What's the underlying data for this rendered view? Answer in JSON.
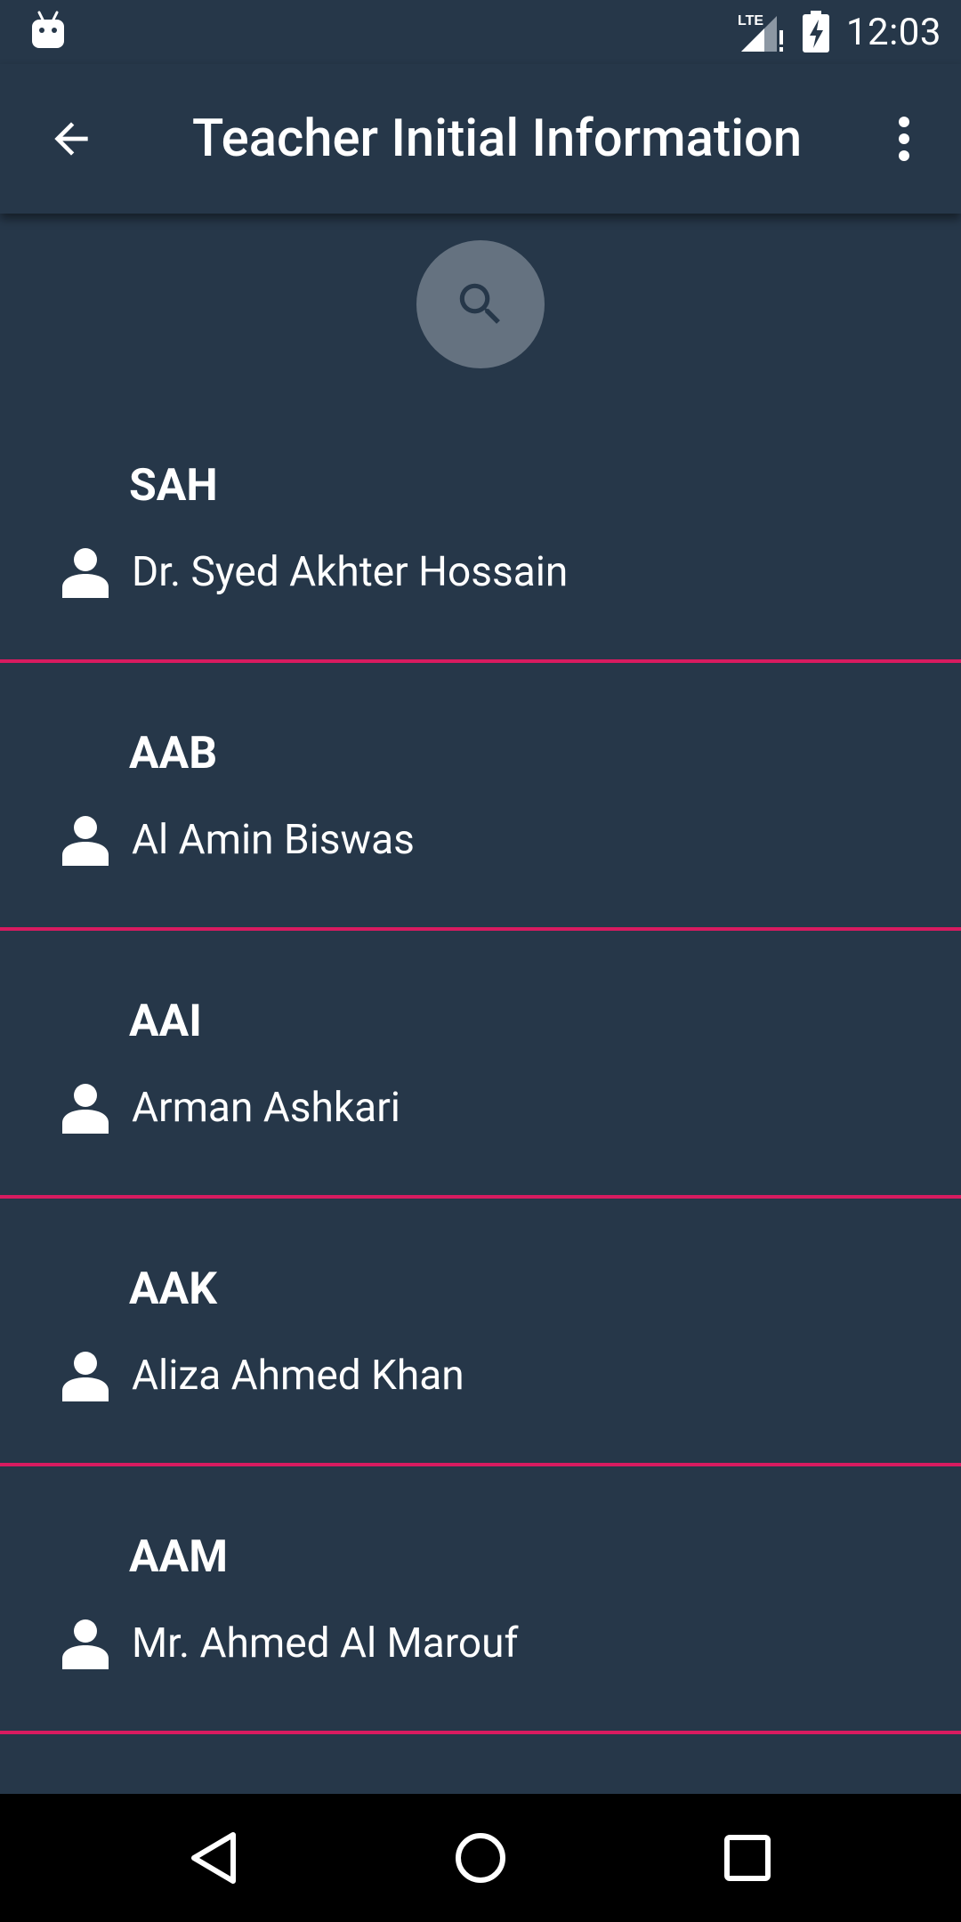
{
  "status_bar": {
    "time": "12:03",
    "network_label": "LTE",
    "icons": [
      "android-debug-icon",
      "lte-signal-icon",
      "battery-charging-icon"
    ]
  },
  "app_bar": {
    "title": "Teacher Initial Information",
    "back_icon": "arrow-back-icon",
    "menu_icon": "more-vert-icon"
  },
  "search": {
    "icon": "search-icon"
  },
  "teachers": [
    {
      "initial": "SAH",
      "name": "Dr. Syed Akhter Hossain"
    },
    {
      "initial": "AAB",
      "name": "Al Amin Biswas"
    },
    {
      "initial": "AAI",
      "name": "Arman Ashkari"
    },
    {
      "initial": "AAK",
      "name": "Aliza Ahmed Khan"
    },
    {
      "initial": "AAM",
      "name": "Mr. Ahmed Al Marouf"
    }
  ],
  "nav_bar": {
    "icons": [
      "back-triangle-icon",
      "home-circle-icon",
      "recents-square-icon"
    ]
  },
  "colors": {
    "background": "#263749",
    "divider": "#d81b60",
    "fab": "#657280",
    "nav_bar": "#000000"
  }
}
